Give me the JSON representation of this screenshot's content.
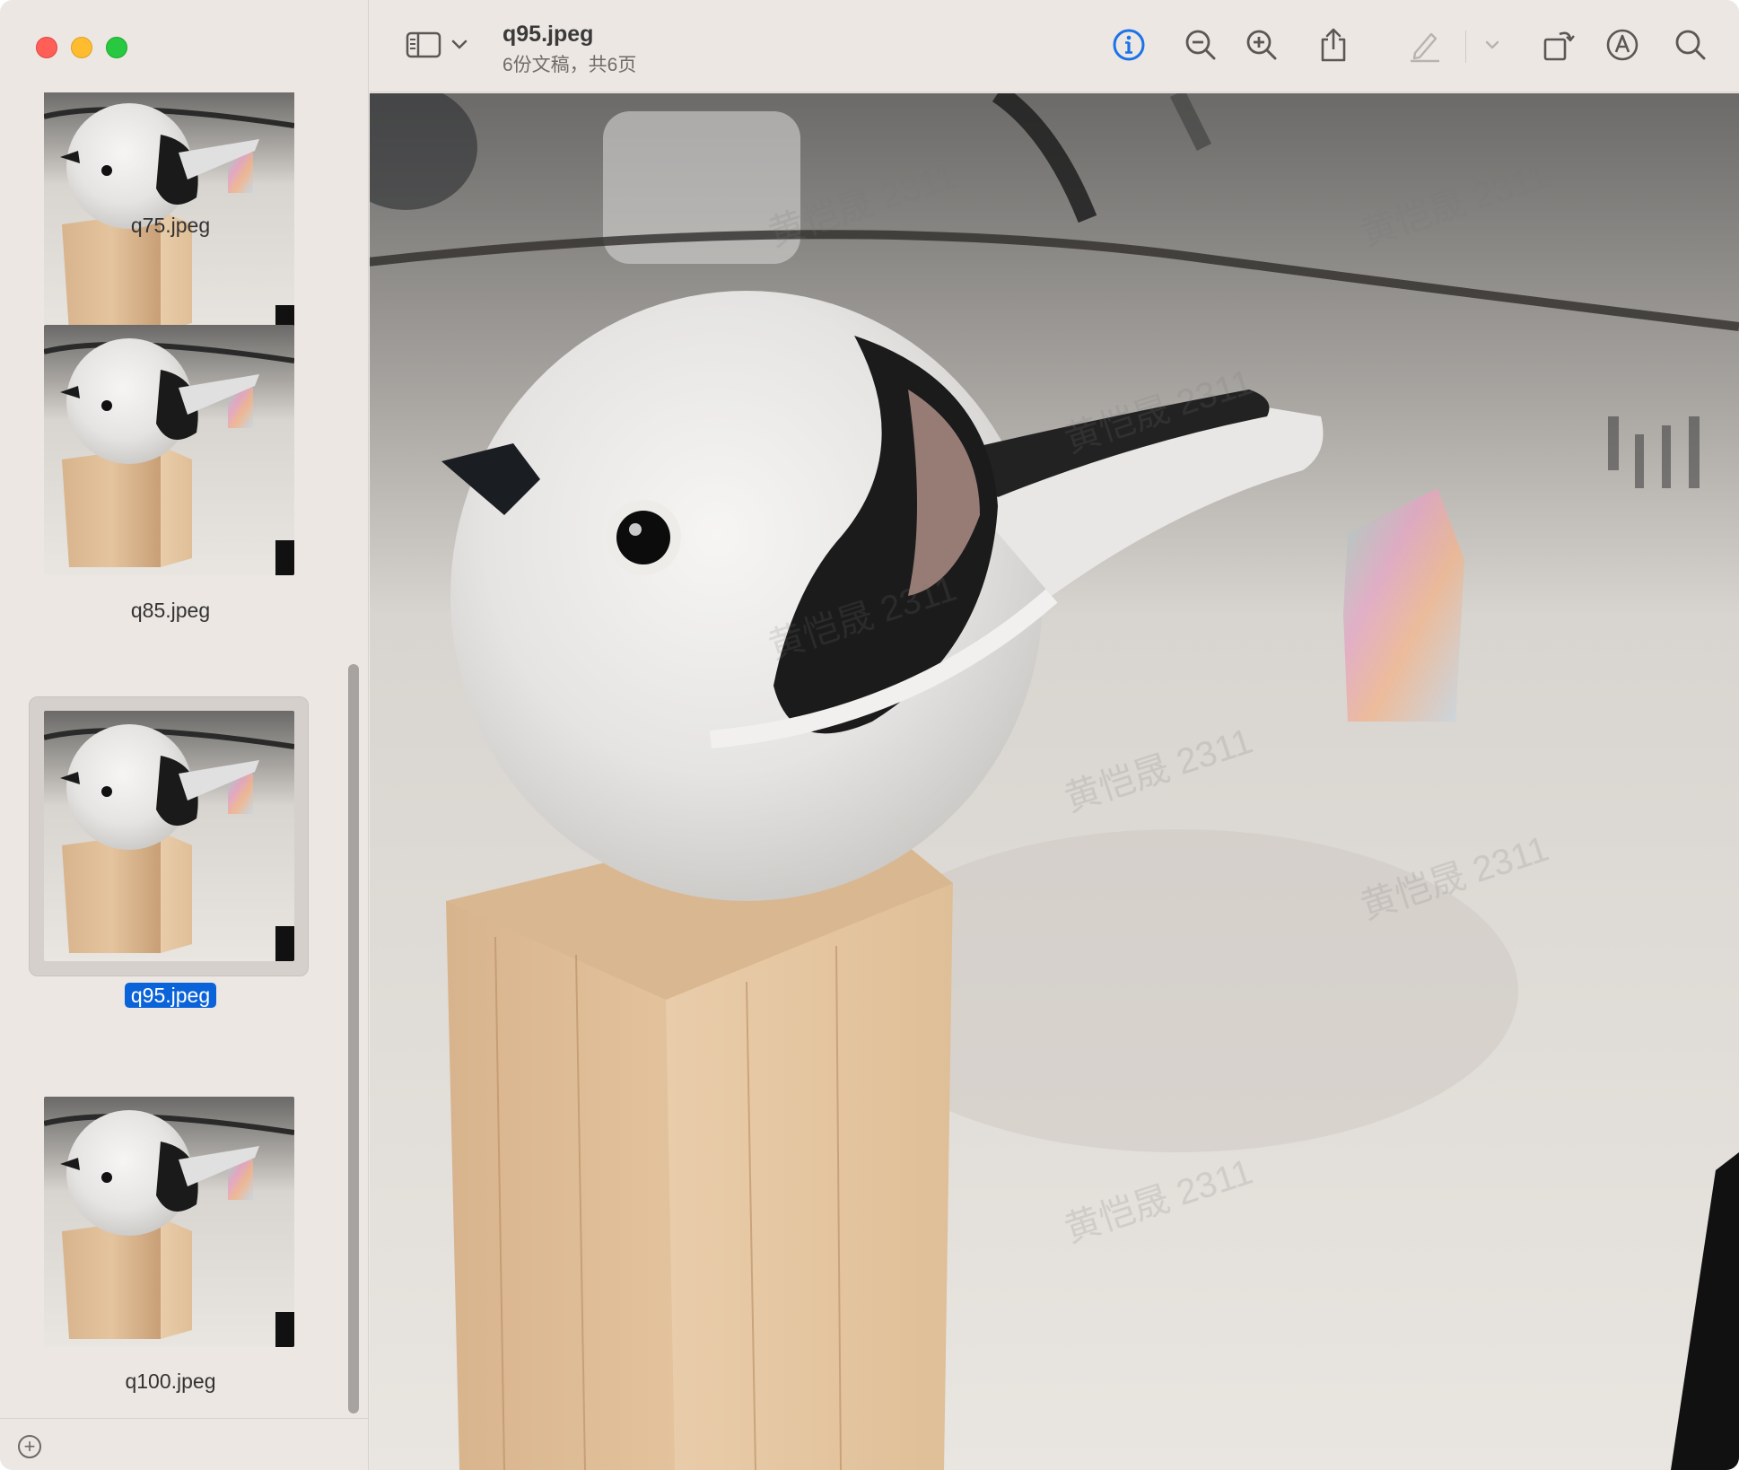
{
  "window": {
    "title": "q95.jpeg",
    "subtitle": "6份文稿，共6页"
  },
  "sidebar": {
    "thumbnails": [
      {
        "label": "q75.jpeg",
        "selected": false
      },
      {
        "label": "q85.jpeg",
        "selected": false
      },
      {
        "label": "q95.jpeg",
        "selected": true
      },
      {
        "label": "q100.jpeg",
        "selected": false
      }
    ],
    "add_label": "+"
  },
  "toolbar": {
    "icons": [
      "sidebar-toggle-icon",
      "chevron-down-icon",
      "info-icon",
      "zoom-out-icon",
      "zoom-in-icon",
      "share-icon",
      "markup-pen-icon",
      "chevron-down-icon",
      "rotate-icon",
      "annotate-icon",
      "search-icon"
    ],
    "accent": "#1a73e8"
  },
  "watermarks": [
    "黄恺晟 2311",
    "黄恺晟 2311",
    "黄恺晟 2311",
    "黄恺晟 2311",
    "黄恺晟 2311",
    "黄恺晟 2311",
    "黄恺晟 2311"
  ],
  "colors": {
    "selection": "#0a63d8",
    "window_bg": "#ece7e3"
  }
}
